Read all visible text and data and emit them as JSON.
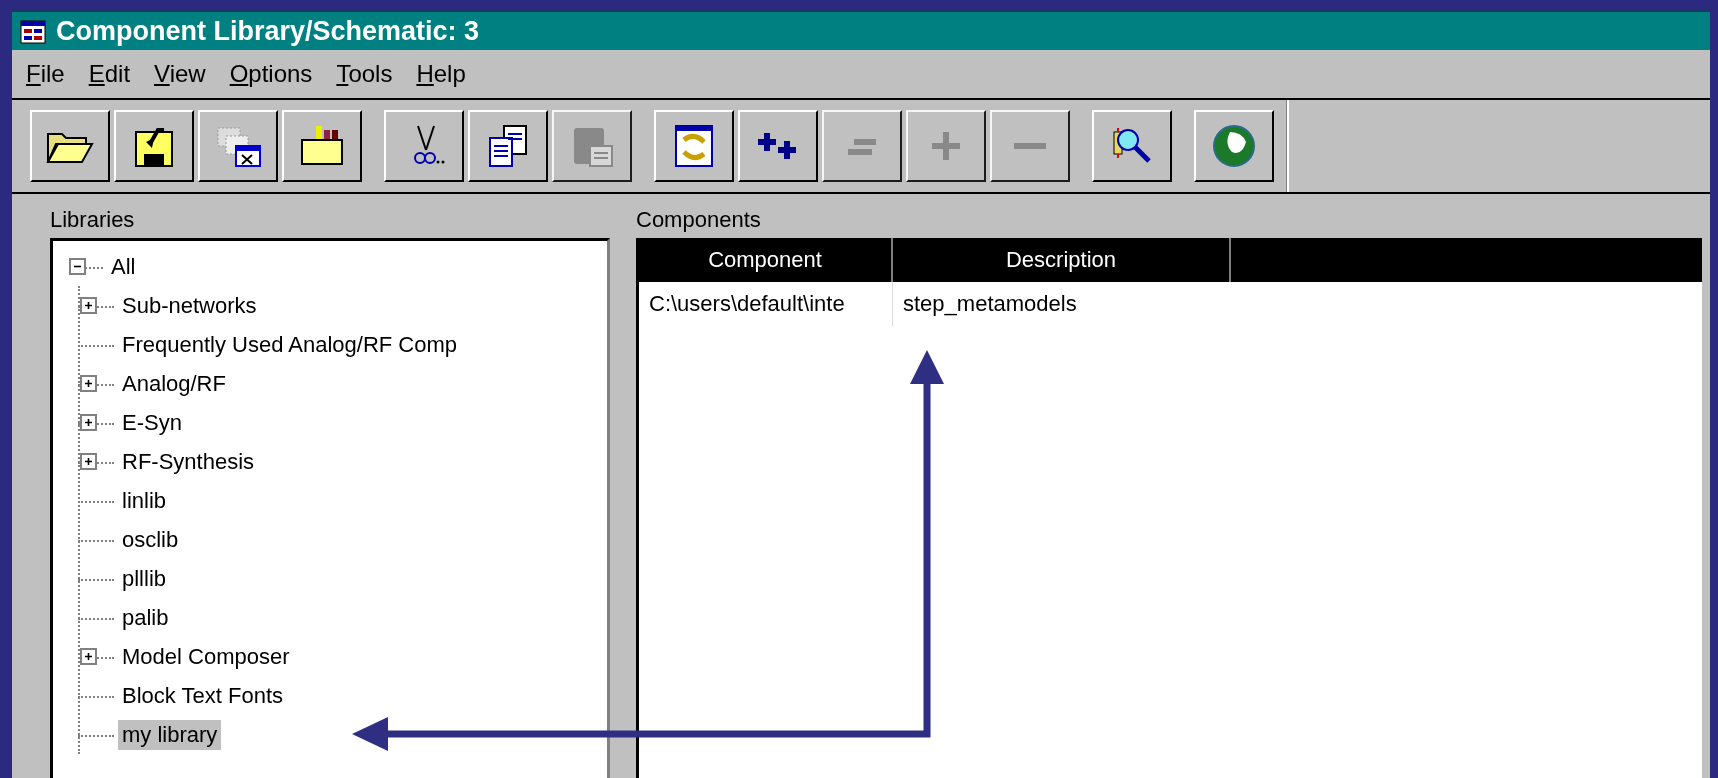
{
  "window": {
    "title": "Component Library/Schematic: 3"
  },
  "menu": [
    {
      "label": "File"
    },
    {
      "label": "Edit"
    },
    {
      "label": "View"
    },
    {
      "label": "Options"
    },
    {
      "label": "Tools"
    },
    {
      "label": "Help"
    }
  ],
  "toolbar_groups": [
    [
      {
        "kind": "open",
        "disabled": false
      },
      {
        "kind": "save",
        "disabled": false
      },
      {
        "kind": "close-window",
        "disabled": false
      },
      {
        "kind": "library",
        "disabled": false
      }
    ],
    [
      {
        "kind": "cut",
        "disabled": false
      },
      {
        "kind": "copy",
        "disabled": false
      },
      {
        "kind": "paste",
        "disabled": true
      }
    ],
    [
      {
        "kind": "refresh",
        "disabled": false
      },
      {
        "kind": "add-all",
        "disabled": false
      },
      {
        "kind": "remove-all",
        "disabled": true
      },
      {
        "kind": "add",
        "disabled": true
      },
      {
        "kind": "remove",
        "disabled": true
      }
    ],
    [
      {
        "kind": "find",
        "disabled": false
      }
    ],
    [
      {
        "kind": "web",
        "disabled": false
      }
    ]
  ],
  "libraries": {
    "label": "Libraries",
    "tree": [
      {
        "label": "All",
        "expandable": true,
        "expanded": true,
        "selected": false,
        "children": [
          {
            "label": "Sub-networks",
            "expandable": true,
            "expanded": false,
            "selected": false
          },
          {
            "label": "Frequently Used Analog/RF Comp",
            "expandable": false,
            "expanded": false,
            "selected": false
          },
          {
            "label": "Analog/RF",
            "expandable": true,
            "expanded": false,
            "selected": false
          },
          {
            "label": "E-Syn",
            "expandable": true,
            "expanded": false,
            "selected": false
          },
          {
            "label": "RF-Synthesis",
            "expandable": true,
            "expanded": false,
            "selected": false
          },
          {
            "label": "linlib",
            "expandable": false,
            "expanded": false,
            "selected": false
          },
          {
            "label": "osclib",
            "expandable": false,
            "expanded": false,
            "selected": false
          },
          {
            "label": "plllib",
            "expandable": false,
            "expanded": false,
            "selected": false
          },
          {
            "label": "palib",
            "expandable": false,
            "expanded": false,
            "selected": false
          },
          {
            "label": "Model Composer",
            "expandable": true,
            "expanded": false,
            "selected": false
          },
          {
            "label": "Block Text Fonts",
            "expandable": false,
            "expanded": false,
            "selected": false
          },
          {
            "label": "my library",
            "expandable": false,
            "expanded": false,
            "selected": true
          }
        ]
      }
    ]
  },
  "components": {
    "label": "Components",
    "columns": [
      "Component",
      "Description"
    ],
    "rows": [
      [
        "C:\\users\\default\\inte",
        "step_metamodels"
      ]
    ]
  }
}
